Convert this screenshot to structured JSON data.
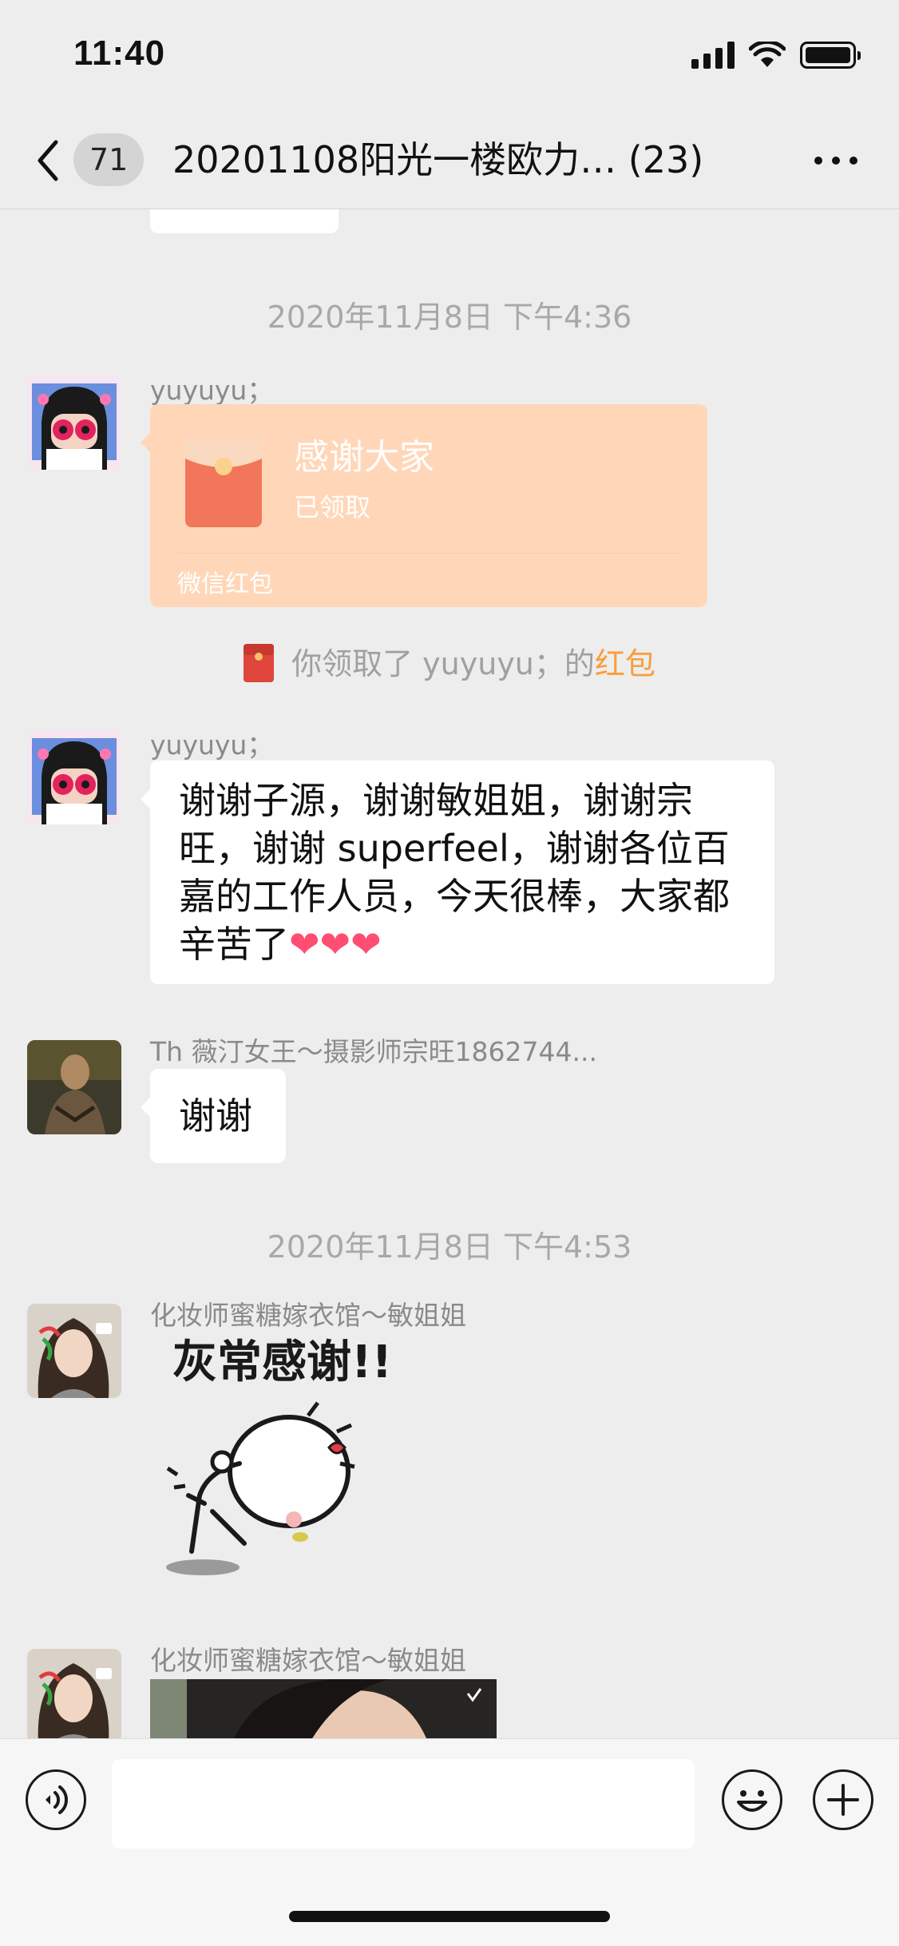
{
  "status_bar": {
    "time": "11:40",
    "icons": [
      "signal-icon",
      "wifi-icon",
      "battery-icon"
    ]
  },
  "nav": {
    "back_icon": "chevron-left-icon",
    "unread_count": "71",
    "title": "20201108阳光一楼欧力…  (23)",
    "more_icon": "more-dots-icon"
  },
  "messages": {
    "timestamp_1": "2020年11月8日 下午4:36",
    "red_packet": {
      "sender": "yuyuyu；",
      "title": "感谢大家",
      "status": "已领取",
      "footer": "微信红包",
      "accent": "#ffd7b8"
    },
    "system_note": {
      "text": "你领取了 yuyuyu；的",
      "link": "红包",
      "link_color": "#fa9d3b"
    },
    "text_message_1": {
      "sender": "yuyuyu；",
      "text": "谢谢子源，谢谢敏姐姐，谢谢宗旺，谢谢 superfeel，谢谢各位百嘉的工作人员，今天很棒，大家都辛苦了",
      "emoji": "❤❤❤"
    },
    "text_message_2": {
      "sender": "Th 薇汀女王～摄影师宗旺1862744...",
      "text": "谢谢"
    },
    "timestamp_2": "2020年11月8日 下午4:53",
    "sticker_message": {
      "sender": "化妆师蜜糖嫁衣馆～敏姐姐",
      "sticker_text": "灰常感谢!!"
    },
    "image_message": {
      "sender": "化妆师蜜糖嫁衣馆～敏姐姐"
    }
  },
  "input_bar": {
    "voice_icon": "voice-icon",
    "placeholder": "",
    "emoji_icon": "smiley-icon",
    "plus_icon": "plus-icon"
  }
}
